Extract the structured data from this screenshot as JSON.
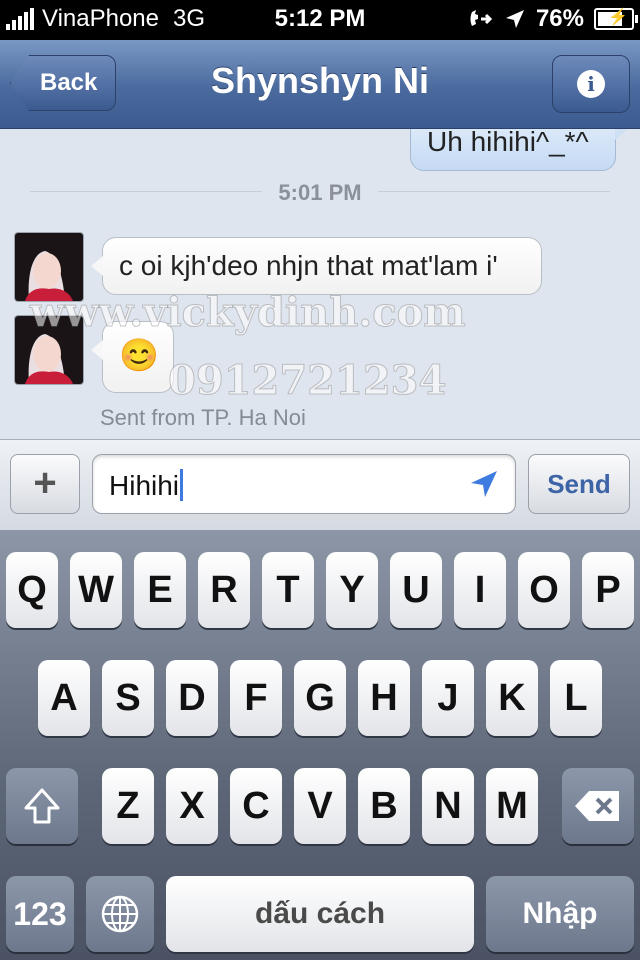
{
  "status_bar": {
    "carrier": "VinaPhone",
    "network": "3G",
    "time": "5:12 PM",
    "battery": "76%",
    "battery_level": 0.76,
    "icons": [
      "signal-bars-icon",
      "call-forward-icon",
      "location-arrow-icon",
      "battery-charging-icon"
    ]
  },
  "nav": {
    "back_label": "Back",
    "title": "Shynshyn Ni",
    "info_icon": "info-icon"
  },
  "chat": {
    "outgoing_partial": "Uh hihihi^_*^",
    "timestamp": "5:01 PM",
    "incoming": [
      {
        "text": "c oi kjh'deo nhjn that mat'lam i'"
      },
      {
        "text": "😊"
      }
    ],
    "sent_from": "Sent from TP. Ha Noi",
    "watermark_site": "www.vickydinh.com",
    "watermark_phone": "0912721234"
  },
  "composer": {
    "plus_label": "+",
    "input_value": "Hihihi",
    "send_label": "Send"
  },
  "keyboard": {
    "row1": [
      "Q",
      "W",
      "E",
      "R",
      "T",
      "Y",
      "U",
      "I",
      "O",
      "P"
    ],
    "row2": [
      "A",
      "S",
      "D",
      "F",
      "G",
      "H",
      "J",
      "K",
      "L"
    ],
    "row3": [
      "Z",
      "X",
      "C",
      "V",
      "B",
      "N",
      "M"
    ],
    "numbers_label": "123",
    "space_label": "dấu cách",
    "return_label": "Nhập"
  },
  "colors": {
    "nav_blue": "#4a6a9e",
    "send_blue": "#3d64a6",
    "caret_blue": "#3d7be0"
  }
}
